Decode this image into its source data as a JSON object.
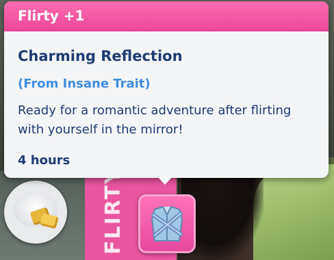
{
  "tooltip": {
    "header": "Flirty +1",
    "title": "Charming Reflection",
    "source": "(From Insane Trait)",
    "description": "Ready for a romantic adventure after flirting with yourself in the mirror!",
    "duration": "4 hours"
  },
  "emotion_strip": {
    "label": "FLIRTY"
  },
  "moodlet": {
    "icon": "mirror-reflection-icon"
  },
  "inventory_item": {
    "icon": "plate-food-icon"
  },
  "colors": {
    "accent_pink": "#e94696",
    "title_navy": "#1f3b73",
    "source_blue": "#3f8fe0"
  }
}
